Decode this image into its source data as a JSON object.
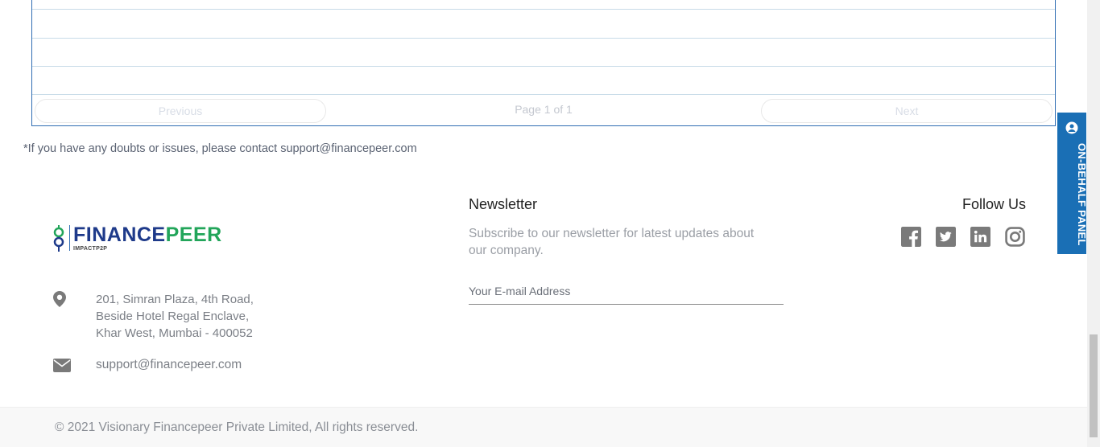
{
  "table": {
    "previous_label": "Previous",
    "next_label": "Next",
    "page_info": "Page 1 of 1"
  },
  "notice": "*If you have any doubts or issues, please contact support@financepeer.com",
  "footer": {
    "brand": {
      "name_part1": "FINANCE",
      "name_part2": "PEER",
      "tagline": "IMPACTP2P"
    },
    "address_lines": [
      "201, Simran Plaza, 4th Road,",
      "Beside Hotel Regal Enclave,",
      "Khar West, Mumbai - 400052"
    ],
    "email": "support@financepeer.com",
    "newsletter": {
      "title": "Newsletter",
      "description": "Subscribe to our newsletter for latest updates about our company.",
      "email_placeholder": "Your E-mail Address"
    },
    "follow": {
      "title": "Follow Us",
      "icons": [
        "facebook-icon",
        "twitter-icon",
        "linkedin-icon",
        "instagram-icon"
      ]
    },
    "copyright": "© 2021 Visionary Financepeer Private Limited, All rights reserved."
  },
  "side_panel": {
    "label": "ON-BEHALF PANEL"
  },
  "colors": {
    "accent": "#1a6fb5",
    "brand_blue": "#1e3a8a",
    "brand_green": "#22a55a",
    "icon_gray": "#7a7a7a"
  }
}
